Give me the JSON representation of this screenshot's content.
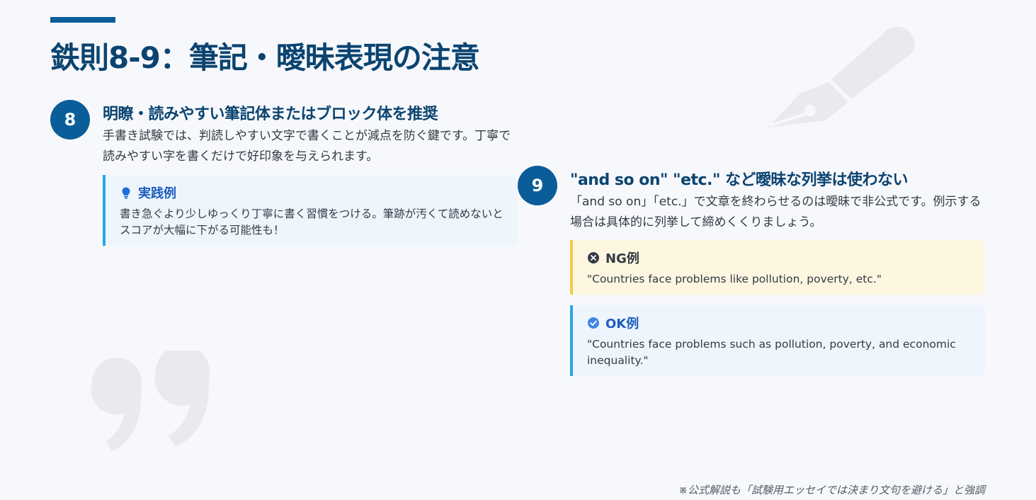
{
  "title": "鉄則8-9：筆記・曖昧表現の注意",
  "section8": {
    "number": "8",
    "heading": "明瞭・読みやすい筆記体またはブロック体を推奨",
    "body": "手書き試験では、判読しやすい文字で書くことが減点を防ぐ鍵です。丁寧で読みやすい字を書くだけで好印象を与えられます。",
    "tip": {
      "icon": "lightbulb-icon",
      "label": "実践例",
      "text": "書き急ぐより少しゆっくり丁寧に書く習慣をつける。筆跡が汚くて読めないとスコアが大幅に下がる可能性も！"
    }
  },
  "section9": {
    "number": "9",
    "heading": "\"and so on\" \"etc.\" など曖昧な列挙は使わない",
    "body": "「and so on」「etc.」で文章を終わらせるのは曖昧で非公式です。例示する場合は具体的に列挙して締めくくりましょう。",
    "ng": {
      "icon": "x-circle-icon",
      "label": "NG例",
      "text": "\"Countries face problems like pollution, poverty, etc.\""
    },
    "ok": {
      "icon": "check-circle-icon",
      "label": "OK例",
      "text": "\"Countries face problems such as pollution, poverty, and economic inequality.\""
    }
  },
  "footnote": "※公式解説も「試験用エッセイでは決まり文句を避ける」と強調",
  "colors": {
    "primary": "#0a5d98",
    "heading": "#0b4470",
    "tip_border": "#2aa6e0",
    "ng_border": "#f2cd45",
    "ng_bg": "#fdf7e1",
    "ok_bg": "#eef5fd",
    "link_blue": "#1c5dbf"
  },
  "decorations": [
    "pen-icon",
    "quote-icon"
  ]
}
